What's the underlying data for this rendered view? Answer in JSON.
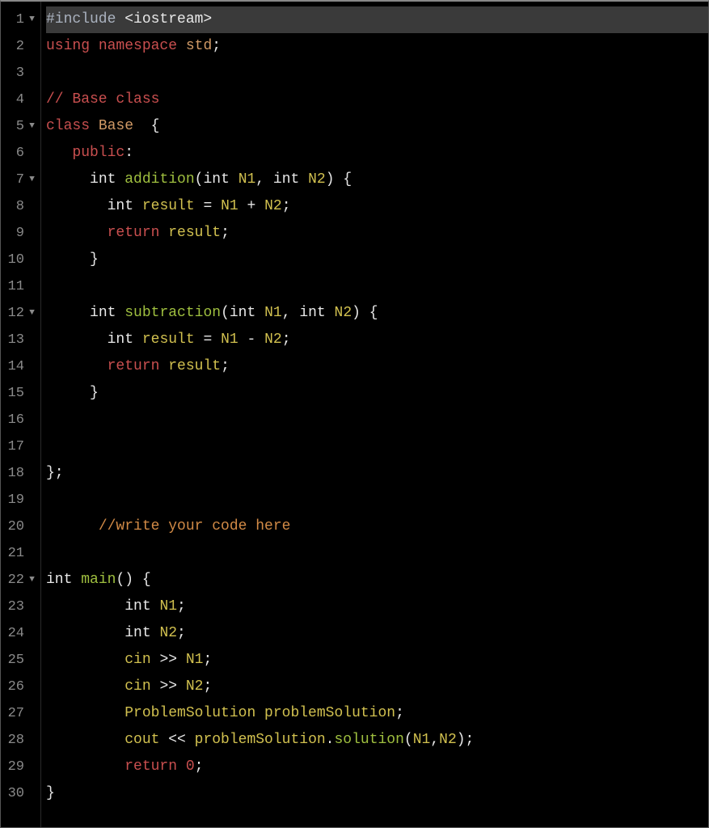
{
  "gutter": {
    "lines": [
      "1",
      "2",
      "3",
      "4",
      "5",
      "6",
      "7",
      "8",
      "9",
      "10",
      "11",
      "12",
      "13",
      "14",
      "15",
      "16",
      "17",
      "18",
      "19",
      "20",
      "21",
      "22",
      "23",
      "24",
      "25",
      "26",
      "27",
      "28",
      "29",
      "30"
    ],
    "fold_rows": [
      1,
      5,
      7,
      12,
      22
    ],
    "fold_glyph": "▼"
  },
  "code": {
    "l1": {
      "a": "#include ",
      "b": "<iostream>"
    },
    "l2": {
      "a": "using ",
      "b": "namespace ",
      "c": "std",
      "d": ";"
    },
    "l3": "",
    "l4": "// Base class",
    "l5": {
      "a": "class ",
      "b": "Base",
      "c": "  {"
    },
    "l6": {
      "a": "   ",
      "b": "public",
      "c": ":"
    },
    "l7": {
      "a": "     ",
      "b": "int ",
      "c": "addition",
      "d": "(",
      "e": "int ",
      "f": "N1",
      "g": ", ",
      "h": "int ",
      "i": "N2",
      "j": ") {"
    },
    "l8": {
      "a": "       ",
      "b": "int ",
      "c": "result ",
      "d": "= ",
      "e": "N1 ",
      "f": "+ ",
      "g": "N2",
      "h": ";"
    },
    "l9": {
      "a": "       ",
      "b": "return ",
      "c": "result",
      "d": ";"
    },
    "l10": "     }",
    "l11": "",
    "l12": {
      "a": "     ",
      "b": "int ",
      "c": "subtraction",
      "d": "(",
      "e": "int ",
      "f": "N1",
      "g": ", ",
      "h": "int ",
      "i": "N2",
      "j": ") {"
    },
    "l13": {
      "a": "       ",
      "b": "int ",
      "c": "result ",
      "d": "= ",
      "e": "N1 ",
      "f": "- ",
      "g": "N2",
      "h": ";"
    },
    "l14": {
      "a": "       ",
      "b": "return ",
      "c": "result",
      "d": ";"
    },
    "l15": "     }",
    "l16": "",
    "l17": "",
    "l18": "};",
    "l19": "",
    "l20": {
      "a": "      ",
      "b": "//write your code here"
    },
    "l21": "",
    "l22": {
      "a": "int ",
      "b": "main",
      "c": "() {"
    },
    "l23": {
      "a": "         ",
      "b": "int ",
      "c": "N1",
      "d": ";"
    },
    "l24": {
      "a": "         ",
      "b": "int ",
      "c": "N2",
      "d": ";"
    },
    "l25": {
      "a": "         ",
      "b": "cin ",
      "c": ">> ",
      "d": "N1",
      "e": ";"
    },
    "l26": {
      "a": "         ",
      "b": "cin ",
      "c": ">> ",
      "d": "N2",
      "e": ";"
    },
    "l27": {
      "a": "         ",
      "b": "ProblemSolution ",
      "c": "problemSolution",
      "d": ";"
    },
    "l28": {
      "a": "         ",
      "b": "cout ",
      "c": "<< ",
      "d": "problemSolution",
      "e": ".",
      "f": "solution",
      "g": "(",
      "h": "N1",
      "i": ",",
      "j": "N2",
      "k": ");"
    },
    "l29": {
      "a": "         ",
      "b": "return ",
      "c": "0",
      "d": ";"
    },
    "l30": "}"
  }
}
